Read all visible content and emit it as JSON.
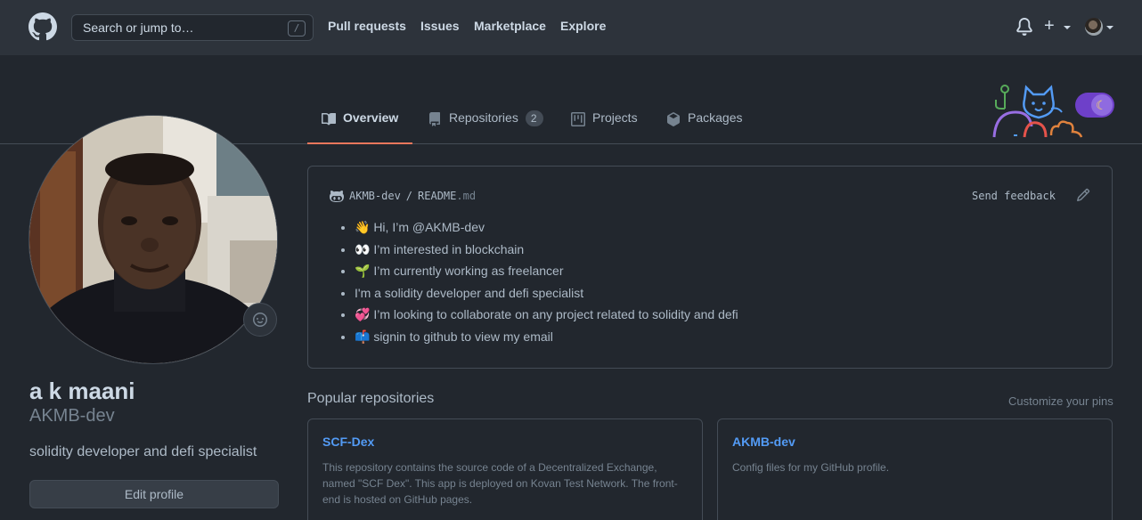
{
  "header": {
    "search_placeholder": "Search or jump to…",
    "search_shortcut": "/",
    "nav": [
      "Pull requests",
      "Issues",
      "Marketplace",
      "Explore"
    ]
  },
  "tabs": {
    "overview": "Overview",
    "repositories": "Repositories",
    "repositories_count": "2",
    "projects": "Projects",
    "packages": "Packages"
  },
  "profile": {
    "full_name": "a k maani",
    "username": "AKMB-dev",
    "bio": "solidity developer and defi specialist",
    "edit_button": "Edit profile"
  },
  "readme": {
    "owner": "AKMB-dev",
    "separator": "/",
    "file_name": "README",
    "file_ext": ".md",
    "send_feedback": "Send feedback",
    "items": [
      "👋 Hi, I’m @AKMB-dev",
      "👀 I’m interested in blockchain",
      "🌱 I’m currently working as freelancer",
      "I'm a solidity developer and defi specialist",
      "💞️ I’m looking to collaborate on any project related to solidity and defi",
      "📫 signin to github to view my email"
    ]
  },
  "popular": {
    "title": "Popular repositories",
    "customize": "Customize your pins",
    "repos": [
      {
        "name": "SCF-Dex",
        "description": "This repository contains the source code of a Decentralized Exchange, named \"SCF Dex\". This app is deployed on Kovan Test Network. The front-end is hosted on GitHub pages."
      },
      {
        "name": "AKMB-dev",
        "description": "Config files for my GitHub profile."
      }
    ]
  },
  "colors": {
    "background": "#22272e",
    "header": "#2d333b",
    "accent_tab": "#ec775c",
    "link": "#539bf5",
    "toggle": "#6e40c9"
  }
}
